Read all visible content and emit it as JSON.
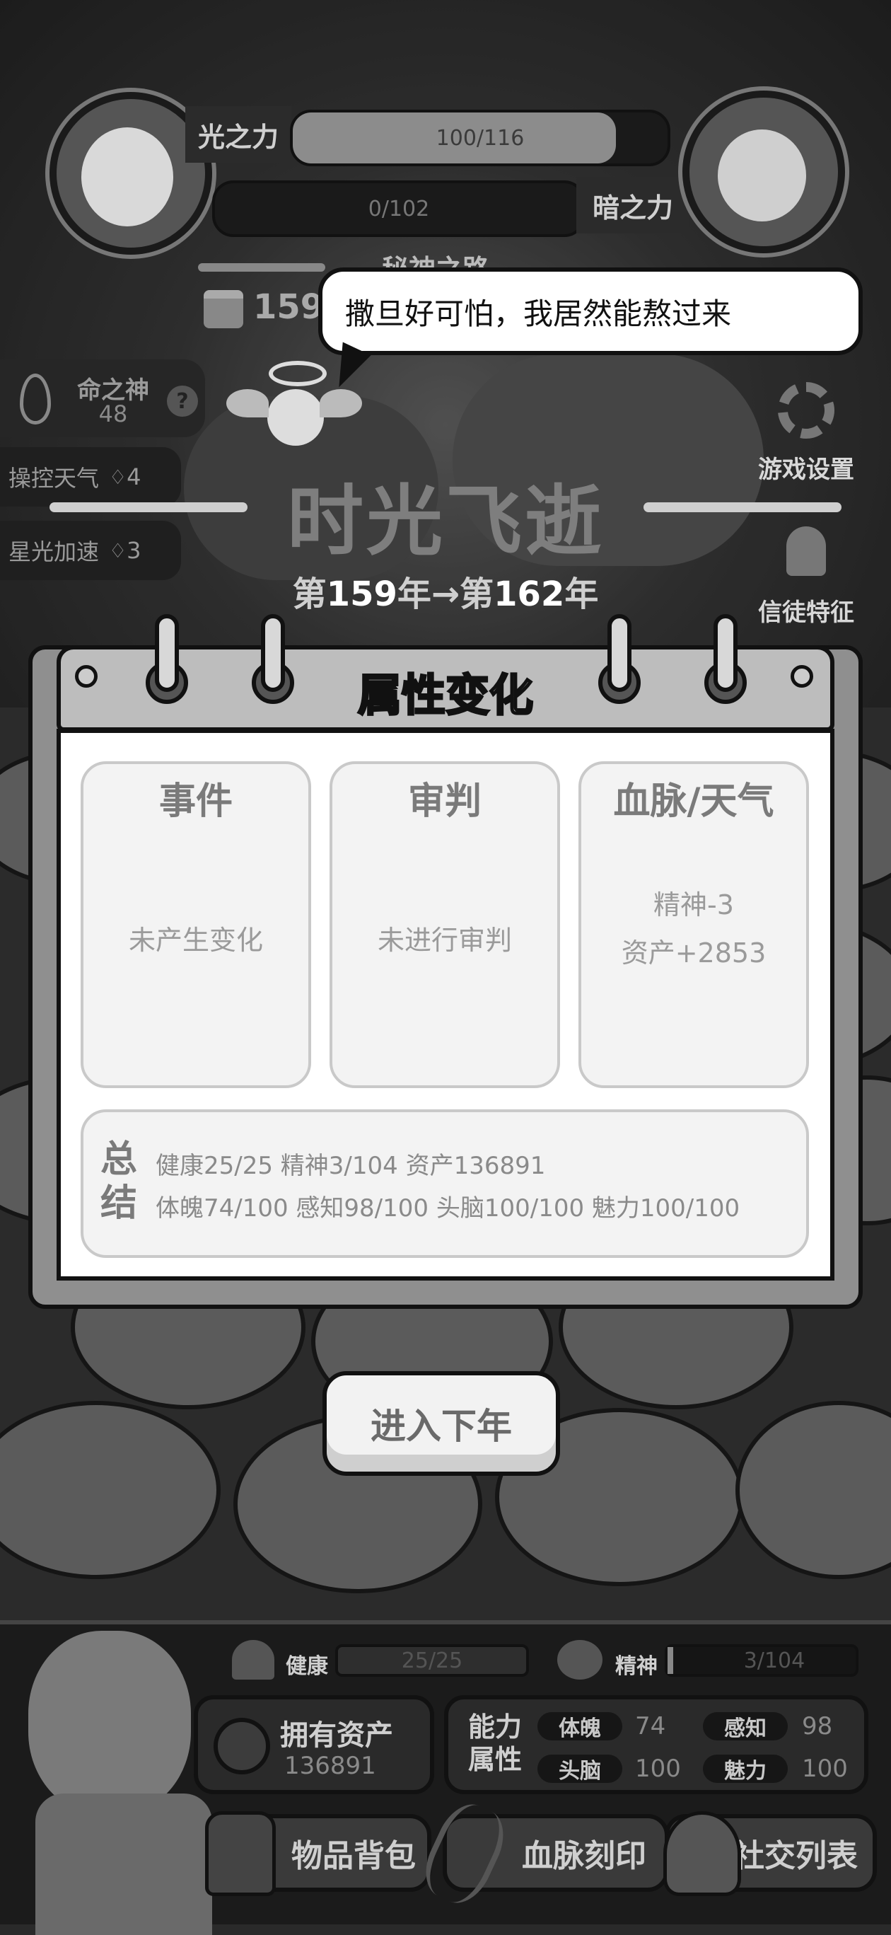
{
  "top": {
    "light": {
      "label": "光之力",
      "value": "100/116",
      "fill": 0.862
    },
    "dark": {
      "label": "暗之力",
      "value": "0/102",
      "fill": 0
    },
    "path_label": "秘神之路",
    "day_count": "159"
  },
  "left_panel": {
    "god": {
      "label": "命之神",
      "value": "48",
      "help": "?"
    },
    "items": [
      {
        "label": "操控天气",
        "count": "4"
      },
      {
        "label": "星光加速",
        "count": "3"
      }
    ]
  },
  "right_panel": {
    "settings_label": "游戏设置",
    "followers_label": "信徒特征"
  },
  "bubble": {
    "text": "撒旦好可怕，我居然能熬过来"
  },
  "title": {
    "main": "时光飞逝",
    "years_prefix": "第",
    "from_year": "159",
    "mid": "年→第",
    "to_year": "162",
    "suffix": "年"
  },
  "panel": {
    "title": "属性变化",
    "cards": [
      {
        "heading": "事件",
        "lines": [
          "未产生变化"
        ]
      },
      {
        "heading": "审判",
        "lines": [
          "未进行审判"
        ]
      },
      {
        "heading": "血脉/天气",
        "lines": [
          "精神-3",
          "资产+2853"
        ]
      }
    ],
    "summary": {
      "label_1": "总",
      "label_2": "结",
      "line1": "健康25/25  精神3/104  资产136891",
      "line2": "体魄74/100  感知98/100  头脑100/100  魅力100/100"
    }
  },
  "next_button": "进入下年",
  "bottom": {
    "health": {
      "label": "健康",
      "value": "25/25",
      "fill": 1.0
    },
    "spirit": {
      "label": "精神",
      "value": "3/104",
      "fill": 0.029
    },
    "assets": {
      "label": "拥有资产",
      "value": "136891"
    },
    "abilities": {
      "label_1": "能力",
      "label_2": "属性",
      "stats": [
        {
          "name": "体魄",
          "value": "74"
        },
        {
          "name": "感知",
          "value": "98"
        },
        {
          "name": "头脑",
          "value": "100"
        },
        {
          "name": "魅力",
          "value": "100"
        }
      ]
    },
    "buttons": {
      "inventory": "物品背包",
      "bloodline": "血脉刻印",
      "social": "社交列表"
    }
  }
}
